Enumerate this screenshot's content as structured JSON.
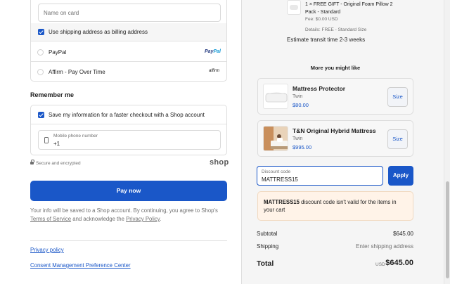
{
  "payment": {
    "name_on_card_placeholder": "Name on card",
    "billing_same_label": "Use shipping address as billing address",
    "billing_same_checked": true,
    "options": [
      {
        "label": "PayPal",
        "logo": "PayPal"
      },
      {
        "label": "Affirm - Pay Over Time",
        "logo": "affirm"
      }
    ]
  },
  "remember": {
    "title": "Remember me",
    "save_label": "Save my information for a faster checkout with a Shop account",
    "save_checked": true,
    "phone_label": "Mobile phone number",
    "phone_value": "+1"
  },
  "security": {
    "secure_text": "Secure and encrypted",
    "shop_logo": "shop"
  },
  "pay_button": "Pay now",
  "legal": {
    "prefix": "Your info will be saved to a Shop account. By continuing, you agree to Shop's",
    "terms": "Terms of Service",
    "middle": "and acknowledge the",
    "privacy": "Privacy Policy",
    "suffix": "."
  },
  "footer_links": [
    "Privacy policy",
    "Consent Management Preference Center"
  ],
  "order": {
    "gift_title": "1 × FREE GIFT - Original Foam Pillow 2 Pack - Standard",
    "gift_fee": "Fee: $0.00 USD",
    "gift_details": "Details: FREE - Standard Size",
    "transit": "Estimate transit time 2-3 weeks"
  },
  "recommendations": {
    "title": "More you might like",
    "items": [
      {
        "name": "Mattress Protector",
        "variant": "Twin",
        "price": "$80.00",
        "button": "Size"
      },
      {
        "name": "T&N Original Hybrid Mattress",
        "variant": "Twin",
        "price": "$995.00",
        "button": "Size"
      }
    ]
  },
  "discount": {
    "label": "Discount code",
    "value": "MATTRESS15",
    "apply": "Apply",
    "error_code": "MATTRESS15",
    "error_text": "discount code isn't valid for the items in your cart"
  },
  "summary": {
    "subtotal_label": "Subtotal",
    "subtotal_value": "$645.00",
    "shipping_label": "Shipping",
    "shipping_value": "Enter shipping address",
    "total_label": "Total",
    "currency": "USD",
    "total_value": "$645.00"
  },
  "colors": {
    "accent": "#1a57c8",
    "alert_bg": "#fff3e8"
  }
}
